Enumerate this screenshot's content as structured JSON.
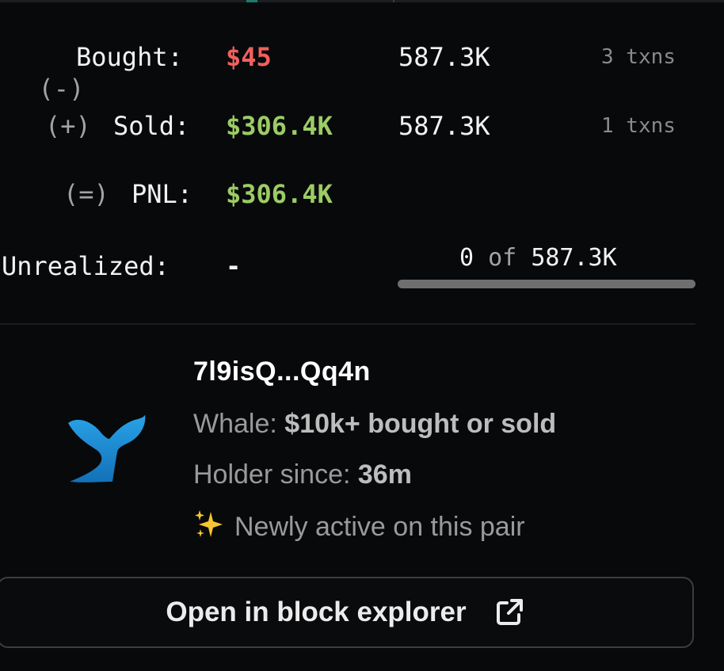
{
  "trades": {
    "bought": {
      "sign": "(-)",
      "label": "Bought:",
      "usd": "$45",
      "amount": "587.3K",
      "txns": "3 txns"
    },
    "sold": {
      "sign": "(+)",
      "label": "Sold:",
      "usd": "$306.4K",
      "amount": "587.3K",
      "txns": "1 txns"
    },
    "pnl": {
      "sign": "(=)",
      "label": "PNL:",
      "usd": "$306.4K"
    },
    "unrealized": {
      "label": "Unrealized:",
      "value": "-"
    },
    "holding": {
      "current": "0",
      "of_word": "of",
      "total": "587.3K",
      "fraction": 0
    }
  },
  "colors": {
    "negative": "#f0605d",
    "positive": "#9ccc65",
    "whale_icon": "#1d8fd6"
  },
  "trader": {
    "icon": "whale-icon",
    "address": "7l9isQ...Qq4n",
    "whale_label": "Whale:",
    "whale_value": "$10k+ bought or sold",
    "holder_label": "Holder since:",
    "holder_value": "36m",
    "sparkle_icon": "sparkles-icon",
    "activity": "Newly active on this pair"
  },
  "explorer_button": {
    "label": "Open in block explorer",
    "icon": "external-link-icon"
  }
}
